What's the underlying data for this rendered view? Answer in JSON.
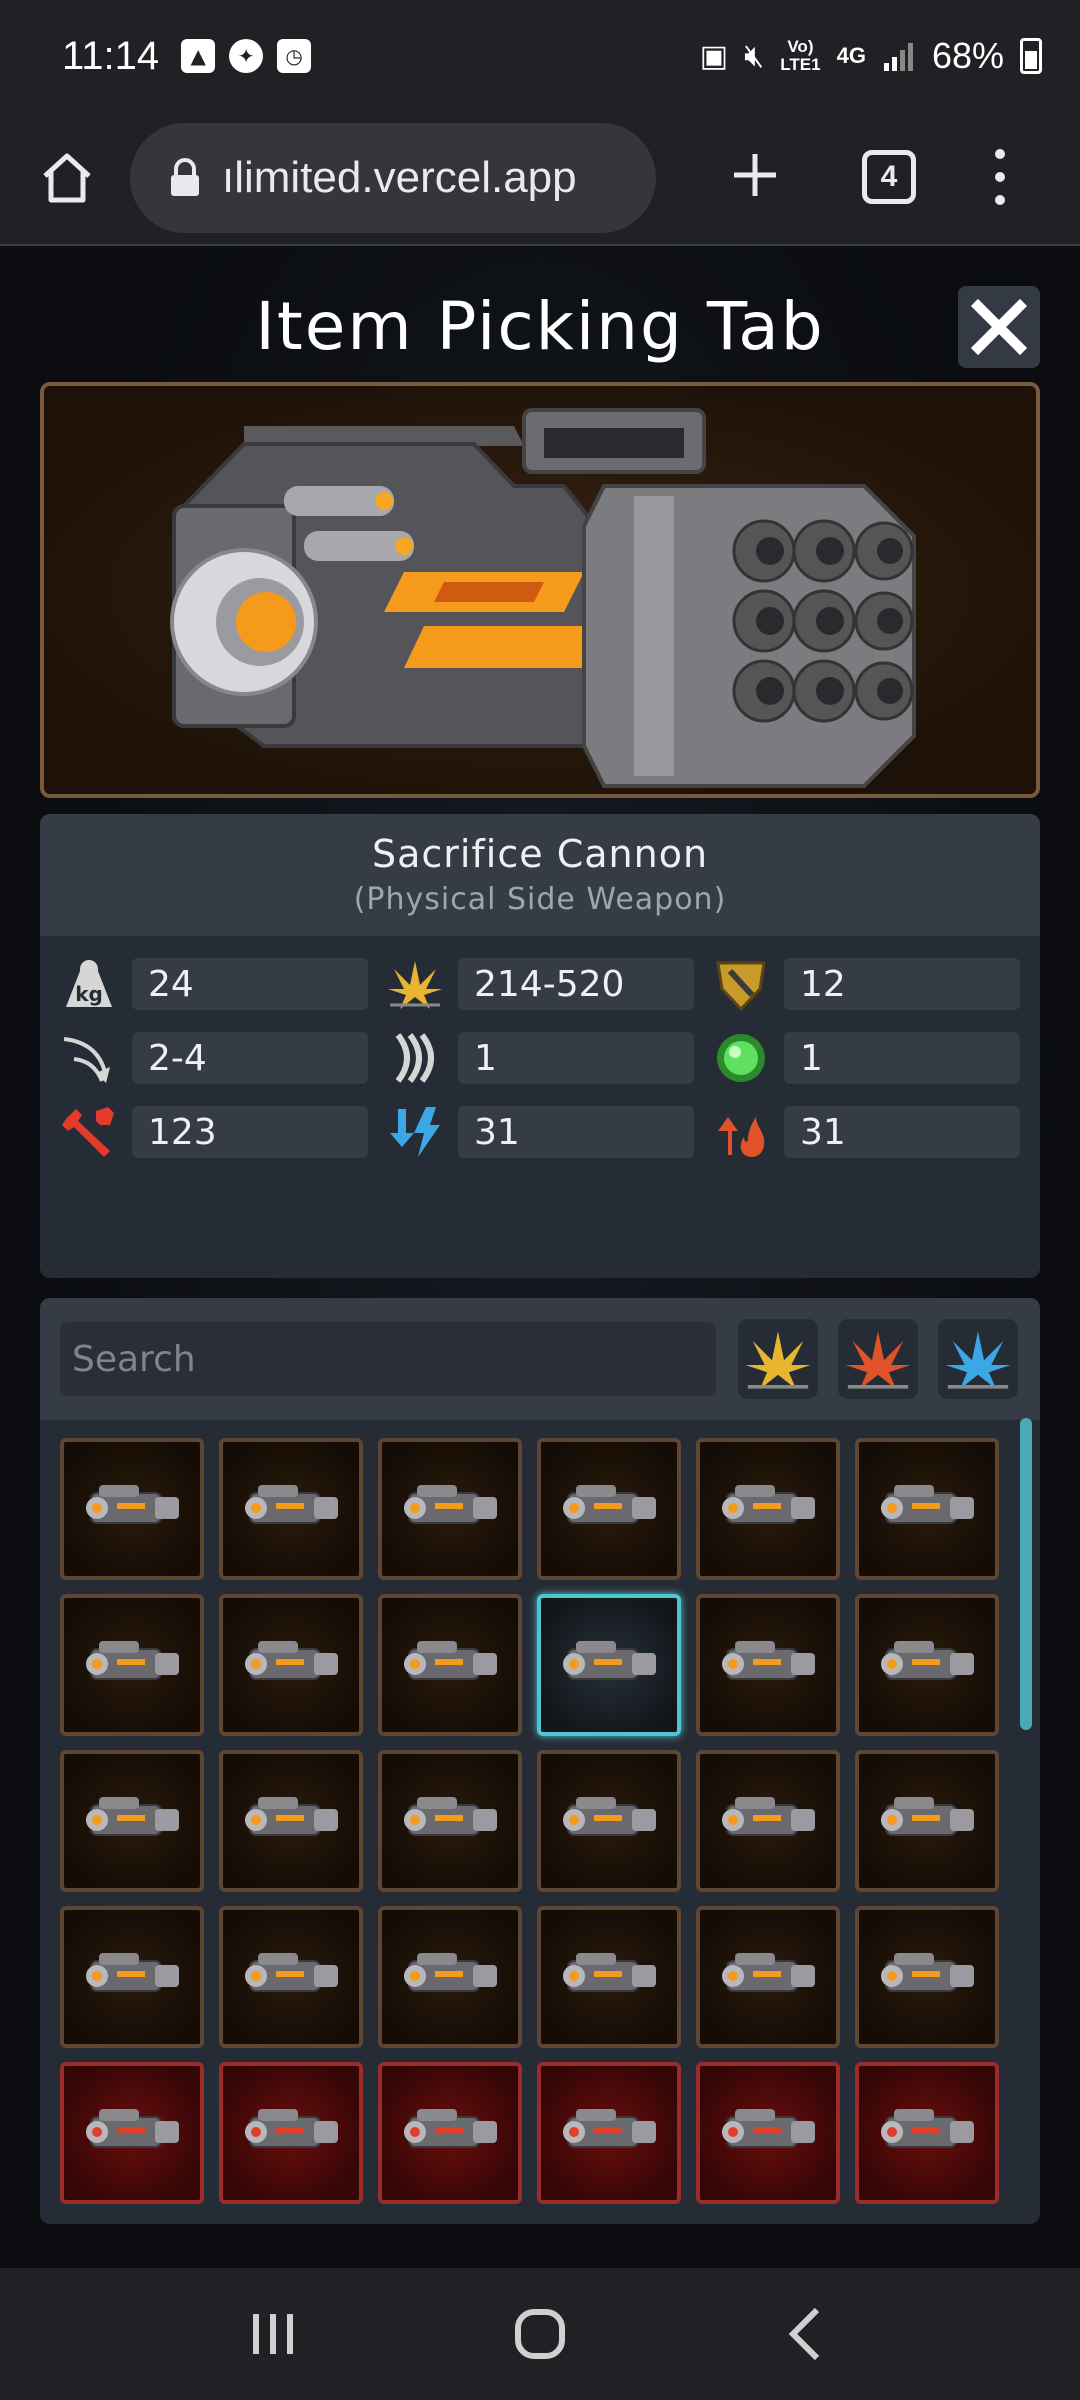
{
  "status_bar": {
    "time": "11:14",
    "network_label_top": "Vo)",
    "network_label_bottom": "LTE1",
    "network_type": "4G",
    "battery_percent": "68%",
    "battery_level": 0.68
  },
  "browser": {
    "url": "ılimited.vercel.app",
    "tab_count": "4"
  },
  "modal": {
    "title": "Item Picking Tab"
  },
  "item": {
    "name": "Sacrifice Cannon",
    "type": "(Physical Side Weapon)",
    "stats": [
      {
        "icon": "weight-kg-icon",
        "value": "24"
      },
      {
        "icon": "physical-damage-icon",
        "value": "214-520"
      },
      {
        "icon": "armor-shield-icon",
        "value": "12"
      },
      {
        "icon": "range-icon",
        "value": "2-4"
      },
      {
        "icon": "uses-per-turn-icon",
        "value": "1"
      },
      {
        "icon": "backfire-orb-icon",
        "value": "1"
      },
      {
        "icon": "repair-wrench-icon",
        "value": "123"
      },
      {
        "icon": "energy-drain-icon",
        "value": "31"
      },
      {
        "icon": "heat-increase-icon",
        "value": "31"
      }
    ]
  },
  "inventory": {
    "search_placeholder": "Search",
    "filters": [
      {
        "icon": "physical-filter-icon",
        "color": "#e8b530"
      },
      {
        "icon": "heat-filter-icon",
        "color": "#e0532a"
      },
      {
        "icon": "energy-filter-icon",
        "color": "#3ba7e6"
      }
    ],
    "selected_index": 9,
    "cells": [
      {
        "style": "normal"
      },
      {
        "style": "normal"
      },
      {
        "style": "normal"
      },
      {
        "style": "normal"
      },
      {
        "style": "normal"
      },
      {
        "style": "normal"
      },
      {
        "style": "normal"
      },
      {
        "style": "normal"
      },
      {
        "style": "normal"
      },
      {
        "style": "selected"
      },
      {
        "style": "normal"
      },
      {
        "style": "normal"
      },
      {
        "style": "normal"
      },
      {
        "style": "normal"
      },
      {
        "style": "normal"
      },
      {
        "style": "normal"
      },
      {
        "style": "normal"
      },
      {
        "style": "normal"
      },
      {
        "style": "normal"
      },
      {
        "style": "normal"
      },
      {
        "style": "normal"
      },
      {
        "style": "normal"
      },
      {
        "style": "normal"
      },
      {
        "style": "normal"
      },
      {
        "style": "red"
      },
      {
        "style": "red"
      },
      {
        "style": "red"
      },
      {
        "style": "red"
      },
      {
        "style": "red"
      },
      {
        "style": "red"
      }
    ]
  },
  "colors": {
    "accent_selected": "#4fc5cf",
    "cell_border": "#5e4632",
    "cell_border_red": "#9a2c2c",
    "panel_bg": "#262c35",
    "panel_header_bg": "#363c46"
  }
}
